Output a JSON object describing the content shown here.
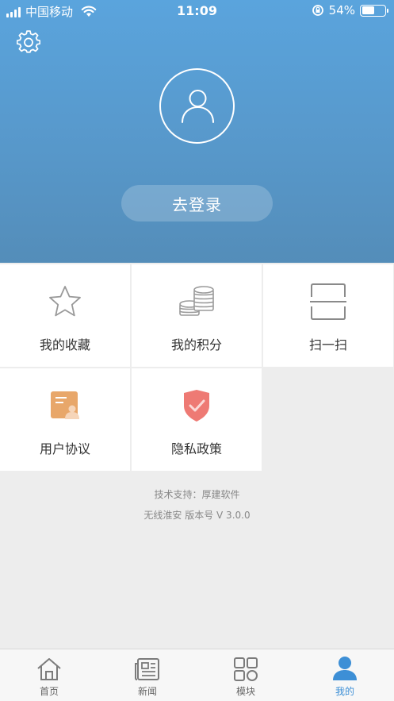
{
  "status_bar": {
    "carrier": "中国移动",
    "time": "11:09",
    "battery": "54%",
    "battery_level": 0.54
  },
  "profile": {
    "login_label": "去登录"
  },
  "menu": [
    {
      "label": "我的收藏",
      "icon": "star-icon"
    },
    {
      "label": "我的积分",
      "icon": "coins-icon"
    },
    {
      "label": "扫一扫",
      "icon": "scan-icon"
    },
    {
      "label": "用户协议",
      "icon": "user-agreement-icon"
    },
    {
      "label": "隐私政策",
      "icon": "shield-check-icon"
    }
  ],
  "footer": {
    "support": "技术支持：厚建软件",
    "version": "无线淮安 版本号 V 3.0.0"
  },
  "tabs": [
    {
      "label": "首页",
      "icon": "home-icon"
    },
    {
      "label": "新闻",
      "icon": "news-icon"
    },
    {
      "label": "模块",
      "icon": "modules-icon"
    },
    {
      "label": "我的",
      "icon": "user-icon",
      "active": true
    }
  ],
  "colors": {
    "header_top": "#5aa4dd",
    "header_bottom": "#548db9",
    "accent": "#3d8fd6",
    "agreement_orange": "#e8a76a",
    "shield_red": "#ee7a74"
  }
}
